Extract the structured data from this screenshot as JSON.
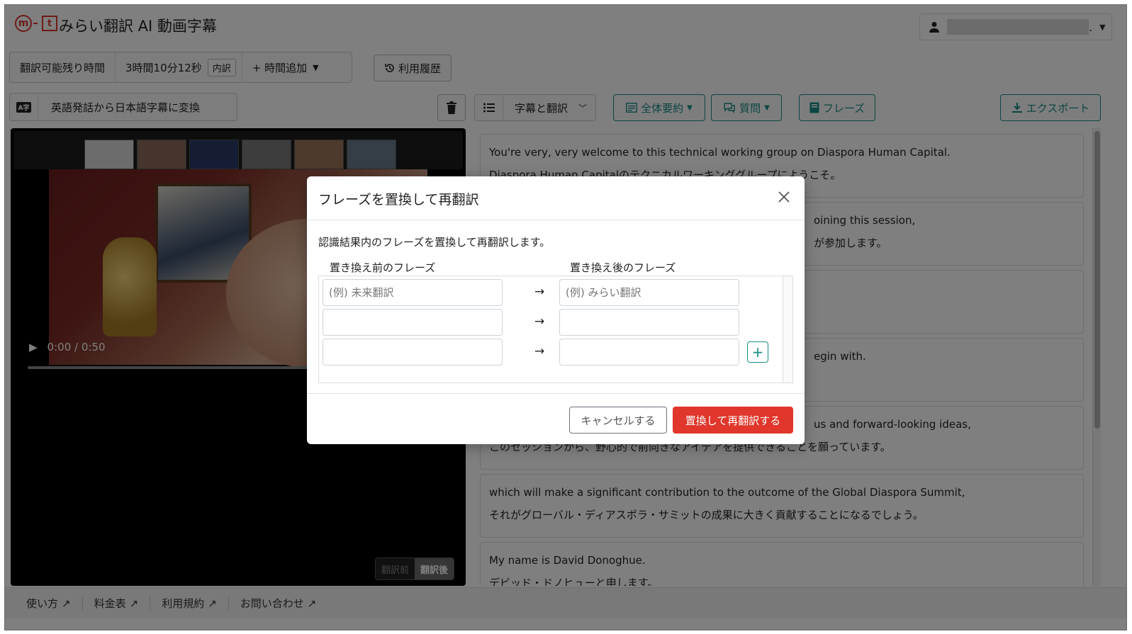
{
  "header": {
    "logo_m": "m",
    "logo_t": "t",
    "app_title": "みらい翻訳 AI 動画字幕",
    "user_suffix": "."
  },
  "toolbar": {
    "remaining_label": "翻訳可能残り時間",
    "remaining_value": "3時間10分12秒",
    "breakdown_label": "内訳",
    "add_time_label": "+ 時間追加",
    "history_label": "利用履歴",
    "mode_badge": "A字",
    "mode_text": "英語発話から日本語字幕に変換",
    "view_select_label": "字幕と翻訳",
    "summary_label": "全体要約",
    "question_label": "質問",
    "phrase_label": "フレーズ",
    "export_label": "エクスポート"
  },
  "video": {
    "time_display": "0:00 / 0:50",
    "progress": 0,
    "toggle_before": "翻訳前",
    "toggle_after": "翻訳後"
  },
  "transcript": {
    "segments": [
      {
        "en": "You're very, very welcome to this technical working group on Diaspora Human Capital.",
        "ja": "Diaspora Human Capitalのテクニカルワーキンググループにようこそ。"
      },
      {
        "en": "oining this session,",
        "ja": "が参加します。"
      },
      {
        "en": "",
        "ja": ""
      },
      {
        "en": "egin with.",
        "ja": ""
      },
      {
        "en": "us and forward-looking ideas,",
        "ja": "このセッションから、野心的で前向きなアイデアを提供できることを願っています。"
      },
      {
        "en": "which will make a significant contribution to the outcome of the Global Diaspora Summit,",
        "ja": "それがグローバル・ディアスポラ・サミットの成果に大きく貢献することになるでしょう。"
      },
      {
        "en": "My name is David Donoghue.",
        "ja": "デビッド・ドノヒューと申します。"
      }
    ]
  },
  "footer": {
    "links": [
      "使い方",
      "料金表",
      "利用規約",
      "お問い合わせ"
    ]
  },
  "modal": {
    "title": "フレーズを置換して再翻訳",
    "description": "認識結果内のフレーズを置換して再翻訳します。",
    "col_before": "置き換え前のフレーズ",
    "col_after": "置き換え後のフレーズ",
    "placeholder_before": "(例) 未来翻訳",
    "placeholder_after": "(例) みらい翻訳",
    "arrow": "→",
    "plus": "+",
    "cancel_label": "キャンセルする",
    "submit_label": "置換して再翻訳する"
  },
  "colors": {
    "brand_red": "#d8382f",
    "accent_teal": "#198c86",
    "submit_red": "#e0362b"
  }
}
